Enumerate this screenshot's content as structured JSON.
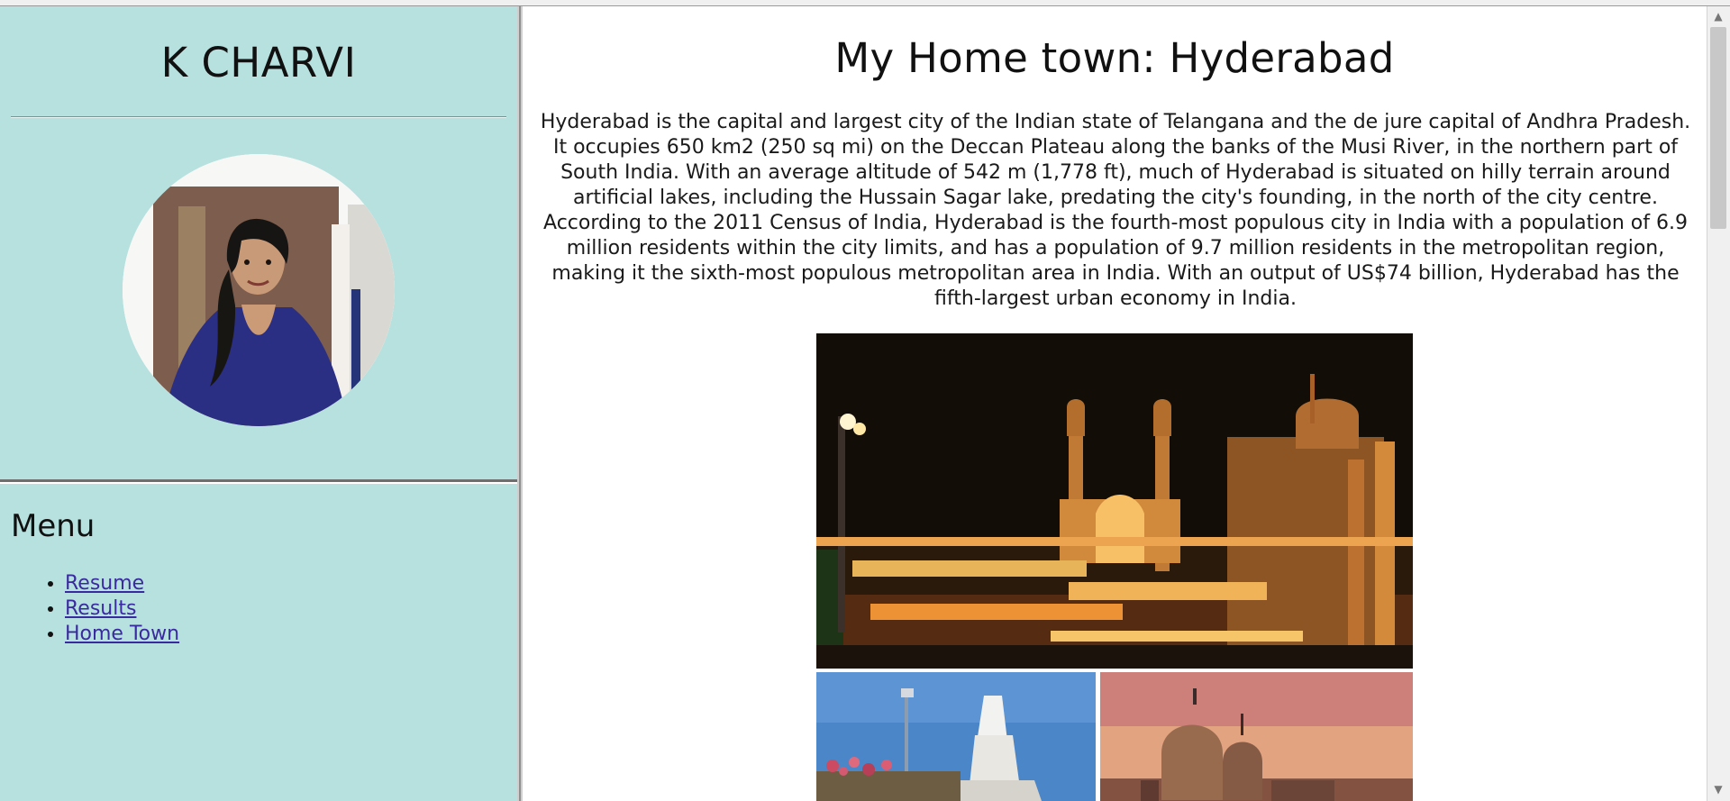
{
  "sidebar": {
    "name": "K CHARVI",
    "menu_title": "Menu",
    "menu_items": [
      "Resume",
      "Results",
      "Home Town"
    ]
  },
  "main": {
    "title": "My Home town: Hyderabad",
    "paragraph": "Hyderabad is the capital and largest city of the Indian state of Telangana and the de jure capital of Andhra Pradesh. It occupies 650 km2 (250 sq mi) on the Deccan Plateau along the banks of the Musi River, in the northern part of South India. With an average altitude of 542 m (1,778 ft), much of Hyderabad is situated on hilly terrain around artificial lakes, including the Hussain Sagar lake, predating the city's founding, in the north of the city centre. According to the 2011 Census of India, Hyderabad is the fourth-most populous city in India with a population of 6.9 million residents within the city limits, and has a population of 9.7 million residents in the metropolitan region, making it the sixth-most populous metropolitan area in India. With an output of US$74 billion, Hyderabad has the fifth-largest urban economy in India."
  },
  "icons": {
    "scroll_up": "scroll-up-arrow-icon",
    "scroll_down": "scroll-down-arrow-icon"
  },
  "colors": {
    "sidebar_bg": "#b7e1de",
    "link": "#3a2aa0"
  }
}
